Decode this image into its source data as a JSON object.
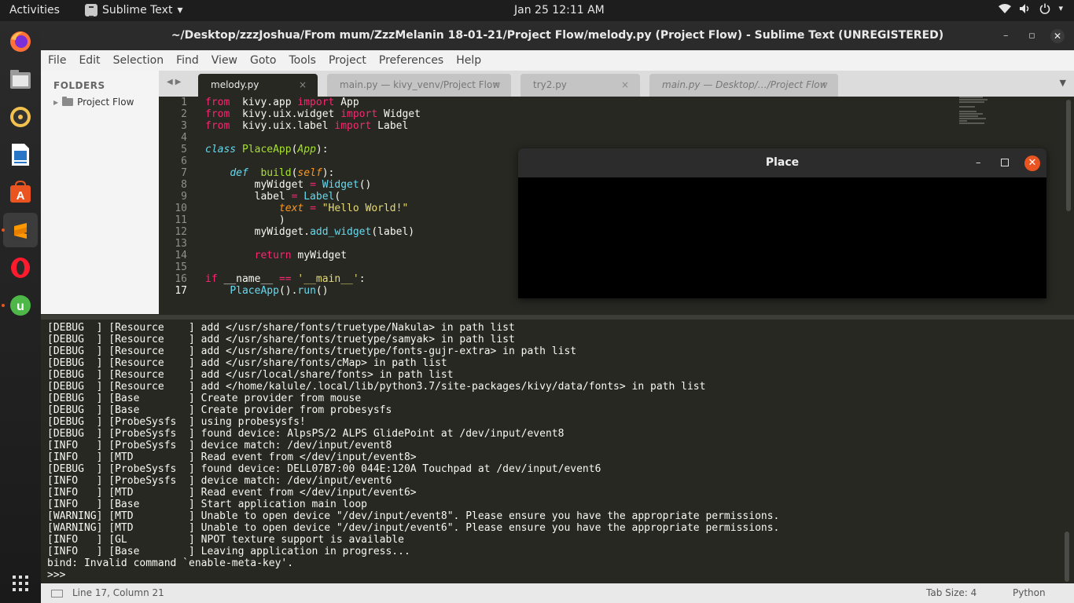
{
  "topbar": {
    "activities": "Activities",
    "app_name": "Sublime Text",
    "clock": "Jan 25  12:11 AM"
  },
  "dock": [
    "firefox-icon",
    "files-icon",
    "rhythmbox-icon",
    "writer-icon",
    "software-icon",
    "sublime-icon",
    "opera-icon",
    "utorrent-icon",
    "apps-grid-icon"
  ],
  "window": {
    "title": "~/Desktop/zzzJoshua/From mum/ZzzMelanin 18-01-21/Project Flow/melody.py (Project Flow) - Sublime Text (UNREGISTERED)"
  },
  "menu": [
    "File",
    "Edit",
    "Selection",
    "Find",
    "View",
    "Goto",
    "Tools",
    "Project",
    "Preferences",
    "Help"
  ],
  "sidebar": {
    "header": "FOLDERS",
    "folder": "Project Flow"
  },
  "tabs": [
    {
      "label": "melody.py",
      "close": "×"
    },
    {
      "label": "main.py — kivy_venv/Project Flow",
      "close": "×"
    },
    {
      "label": "try2.py",
      "close": "×"
    },
    {
      "label": "main.py — Desktop/…/Project Flow",
      "close": "×"
    }
  ],
  "editor": {
    "line_numbers": [
      "1",
      "2",
      "3",
      "4",
      "5",
      "6",
      "7",
      "8",
      "9",
      "10",
      "11",
      "12",
      "13",
      "14",
      "15",
      "16",
      "17"
    ]
  },
  "place_window": {
    "title": "Place"
  },
  "console": {
    "lines": [
      "[DEBUG  ] [Resource    ] add </usr/share/fonts/truetype/Nakula> in path list",
      "[DEBUG  ] [Resource    ] add </usr/share/fonts/truetype/samyak> in path list",
      "[DEBUG  ] [Resource    ] add </usr/share/fonts/truetype/fonts-gujr-extra> in path list",
      "[DEBUG  ] [Resource    ] add </usr/share/fonts/cMap> in path list",
      "[DEBUG  ] [Resource    ] add </usr/local/share/fonts> in path list",
      "[DEBUG  ] [Resource    ] add </home/kalule/.local/lib/python3.7/site-packages/kivy/data/fonts> in path list",
      "[DEBUG  ] [Base        ] Create provider from mouse",
      "[DEBUG  ] [Base        ] Create provider from probesysfs",
      "[DEBUG  ] [ProbeSysfs  ] using probesysfs!",
      "[DEBUG  ] [ProbeSysfs  ] found device: AlpsPS/2 ALPS GlidePoint at /dev/input/event8",
      "[INFO   ] [ProbeSysfs  ] device match: /dev/input/event8",
      "[INFO   ] [MTD         ] Read event from </dev/input/event8>",
      "[DEBUG  ] [ProbeSysfs  ] found device: DELL07B7:00 044E:120A Touchpad at /dev/input/event6",
      "[INFO   ] [ProbeSysfs  ] device match: /dev/input/event6",
      "[INFO   ] [MTD         ] Read event from </dev/input/event6>",
      "[INFO   ] [Base        ] Start application main loop",
      "[WARNING] [MTD         ] Unable to open device \"/dev/input/event8\". Please ensure you have the appropriate permissions.",
      "[WARNING] [MTD         ] Unable to open device \"/dev/input/event6\". Please ensure you have the appropriate permissions.",
      "[INFO   ] [GL          ] NPOT texture support is available",
      "[INFO   ] [Base        ] Leaving application in progress...",
      "bind: Invalid command `enable-meta-key'.",
      ">>>"
    ]
  },
  "status": {
    "position": "Line 17, Column 21",
    "tab_size": "Tab Size: 4",
    "syntax": "Python"
  },
  "colors": {
    "editor_bg": "#272822",
    "accent_orange": "#e95420",
    "keyword": "#f92672",
    "string": "#e6db74"
  }
}
